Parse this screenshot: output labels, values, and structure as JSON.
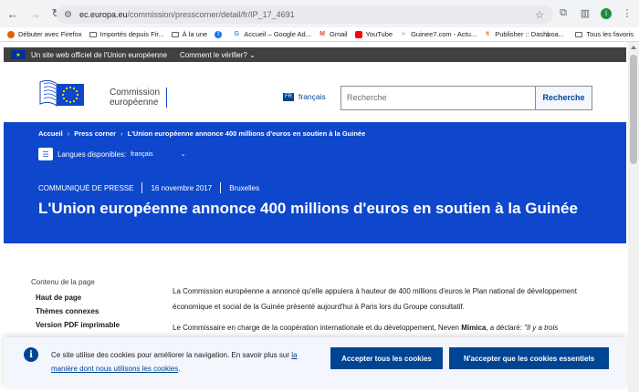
{
  "browser": {
    "url_host": "ec.europa.eu",
    "url_path": "/commission/presscorner/detail/fr/IP_17_4691",
    "profile_initial": "i"
  },
  "bookmarks": {
    "items": [
      {
        "label": "Débuter avec Firefox",
        "icon": "firefox-icon"
      },
      {
        "label": "Importés depuis Fir...",
        "icon": "folder-icon"
      },
      {
        "label": "À la une",
        "icon": "folder-icon"
      },
      {
        "label": "",
        "icon": "facebook-icon"
      },
      {
        "label": "Accueil – Google Ad...",
        "icon": "google-ads-icon"
      },
      {
        "label": "Gmail",
        "icon": "gmail-icon"
      },
      {
        "label": "YouTube",
        "icon": "youtube-icon"
      },
      {
        "label": "Guinee7.com - Actu...",
        "icon": "guinee7-icon"
      },
      {
        "label": "Publisher :: Dashboa...",
        "icon": "publisher-icon"
      }
    ],
    "more": "»",
    "all_label": "Tous les favoris"
  },
  "eu_bar": {
    "official_text": "Un site web officiel de l'Union européenne",
    "verify_text": "Comment le vérifier?"
  },
  "header": {
    "logo_line1": "Commission",
    "logo_line2": "européenne",
    "lang_code": "FR",
    "lang_label": "français",
    "search_placeholder": "Recherche",
    "search_button": "Recherche"
  },
  "hero": {
    "breadcrumb": [
      "Accueil",
      "Press corner",
      "L'Union européenne annonce 400 millions d'euros en soutien à la Guinée"
    ],
    "languages_label": "Langues disponibles:",
    "languages_value": "français",
    "type": "COMMUNIQUÉ DE PRESSE",
    "date": "16 novembre 2017",
    "location": "Bruxelles",
    "title": "L'Union européenne annonce 400 millions d'euros en soutien à la Guinée"
  },
  "toc": {
    "title": "Contenu de la page",
    "items": [
      "Haut de page",
      "Thèmes connexes",
      "Version PDF imprimable"
    ]
  },
  "article": {
    "p1": "La Commission européenne a annoncé qu'elle appuiera à hauteur de 400 millions d'euros le Plan national de développement économique et social de la Guinée présenté aujourd'hui à Paris lors du Groupe consultatif.",
    "p2_start": "Le Commissaire en charge de la coopération internationale et du développement, Neven",
    "p2_name": "Mimica",
    "p2_mid": ", a déclaré:",
    "p2_quote": "\"Il y a trois"
  },
  "cookie": {
    "text": "Ce site utilise des cookies pour améliorer la navigation. En savoir plus sur",
    "link": "la manière dont nous utilisons les cookies",
    "link_suffix": ".",
    "accept": "Accepter tous les cookies",
    "refuse": "N'accepter que les cookies essentiels"
  }
}
